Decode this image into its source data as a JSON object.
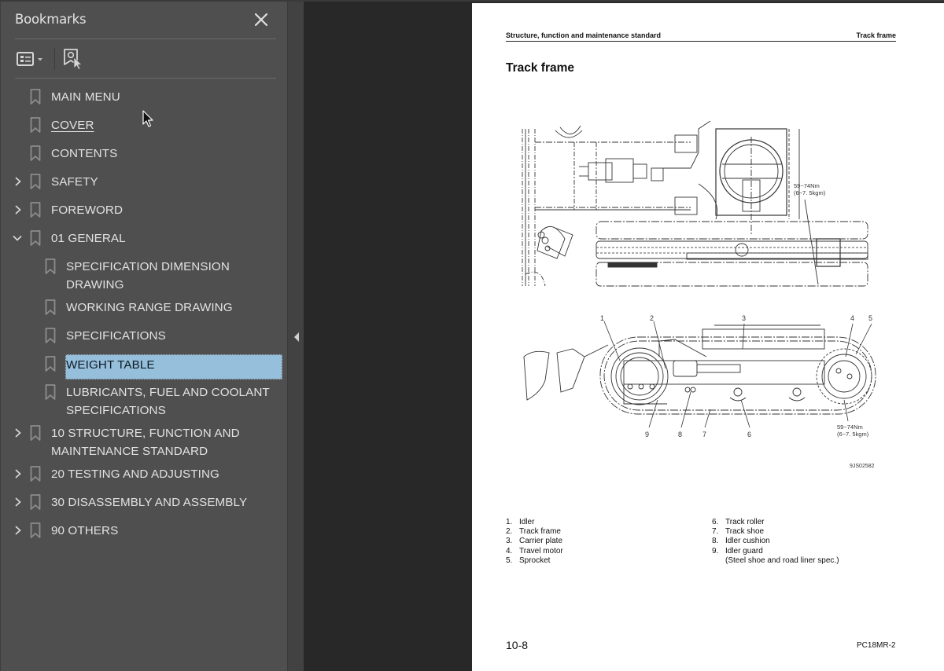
{
  "sidebar": {
    "title": "Bookmarks",
    "close_icon": "close-icon",
    "toolbar": {
      "options_icon": "list-options-icon",
      "find_bookmark_icon": "find-current-bookmark-icon"
    },
    "items": [
      {
        "label": "MAIN MENU",
        "level": 0,
        "expander": "none"
      },
      {
        "label": "COVER",
        "level": 0,
        "expander": "none",
        "underlined": true
      },
      {
        "label": "CONTENTS",
        "level": 0,
        "expander": "none"
      },
      {
        "label": "SAFETY",
        "level": 0,
        "expander": "collapsed"
      },
      {
        "label": "FOREWORD",
        "level": 0,
        "expander": "collapsed"
      },
      {
        "label": "01 GENERAL",
        "level": 0,
        "expander": "expanded"
      },
      {
        "label": "SPECIFICATION DIMENSION DRAWING",
        "level": 1,
        "expander": "none"
      },
      {
        "label": "WORKING RANGE DRAWING",
        "level": 1,
        "expander": "none"
      },
      {
        "label": "SPECIFICATIONS",
        "level": 1,
        "expander": "none"
      },
      {
        "label": "WEIGHT TABLE",
        "level": 1,
        "expander": "none",
        "selected": true
      },
      {
        "label": "LUBRICANTS, FUEL AND COOLANT SPECIFICATIONS",
        "level": 1,
        "expander": "none"
      },
      {
        "label": "10 STRUCTURE, FUNCTION AND MAINTENANCE STANDARD",
        "level": 0,
        "expander": "collapsed"
      },
      {
        "label": "20 TESTING AND ADJUSTING",
        "level": 0,
        "expander": "collapsed"
      },
      {
        "label": "30 DISASSEMBLY AND ASSEMBLY",
        "level": 0,
        "expander": "collapsed"
      },
      {
        "label": "90 OTHERS",
        "level": 0,
        "expander": "collapsed"
      }
    ],
    "selection_color": "#96bfdb"
  },
  "page": {
    "running_head_left": "Structure, function and maintenance standard",
    "running_head_right": "Track frame",
    "title": "Track frame",
    "drawing": {
      "torque_top": [
        "59~74Nm",
        "(6~7. 5kgm)"
      ],
      "torque_bottom": [
        "59~74Nm",
        "(6~7. 5kgm)"
      ],
      "figure_id": "9JS02582",
      "callouts": [
        "1",
        "2",
        "3",
        "4",
        "5",
        "9",
        "8",
        "7",
        "6"
      ]
    },
    "legend_left": [
      {
        "num": "1.",
        "text": "Idler"
      },
      {
        "num": "2.",
        "text": "Track frame"
      },
      {
        "num": "3.",
        "text": "Carrier plate"
      },
      {
        "num": "4.",
        "text": "Travel motor"
      },
      {
        "num": "5.",
        "text": "Sprocket"
      }
    ],
    "legend_right": [
      {
        "num": "6.",
        "text": "Track roller"
      },
      {
        "num": "7.",
        "text": "Track shoe"
      },
      {
        "num": "8.",
        "text": "Idler cushion"
      },
      {
        "num": "9.",
        "text": "Idler guard"
      },
      {
        "num": "",
        "text": "(Steel shoe and road liner spec.)"
      }
    ],
    "folio": "10-8",
    "model": "PC18MR-2"
  }
}
